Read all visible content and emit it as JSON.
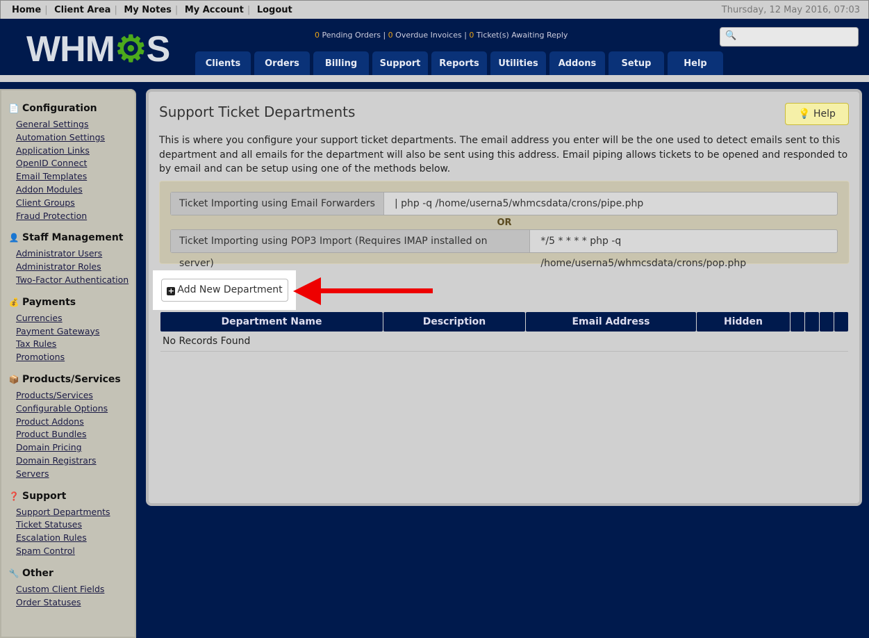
{
  "topbar": {
    "links": [
      "Home",
      "Client Area",
      "My Notes",
      "My Account",
      "Logout"
    ],
    "date": "Thursday, 12 May 2016, 07:03"
  },
  "header": {
    "logo": "WHMCS",
    "stats": {
      "pending": "0",
      "pending_label": "Pending Orders",
      "overdue": "0",
      "overdue_label": "Overdue Invoices",
      "tickets": "0",
      "tickets_label": "Ticket(s) Awaiting Reply"
    },
    "search_placeholder": "",
    "tabs": [
      "Clients",
      "Orders",
      "Billing",
      "Support",
      "Reports",
      "Utilities",
      "Addons",
      "Setup",
      "Help"
    ]
  },
  "sidebar": [
    {
      "title": "Configuration",
      "icon": "config-icon",
      "items": [
        "General Settings",
        "Automation Settings",
        "Application Links",
        "OpenID Connect",
        "Email Templates",
        "Addon Modules",
        "Client Groups",
        "Fraud Protection"
      ]
    },
    {
      "title": "Staff Management",
      "icon": "user-icon",
      "items": [
        "Administrator Users",
        "Administrator Roles",
        "Two-Factor Authentication"
      ]
    },
    {
      "title": "Payments",
      "icon": "coins-icon",
      "items": [
        "Currencies",
        "Payment Gateways",
        "Tax Rules",
        "Promotions"
      ]
    },
    {
      "title": "Products/Services",
      "icon": "box-icon",
      "items": [
        "Products/Services",
        "Configurable Options",
        "Product Addons",
        "Product Bundles",
        "Domain Pricing",
        "Domain Registrars",
        "Servers"
      ]
    },
    {
      "title": "Support",
      "icon": "support-icon",
      "items": [
        "Support Departments",
        "Ticket Statuses",
        "Escalation Rules",
        "Spam Control"
      ]
    },
    {
      "title": "Other",
      "icon": "wrench-icon",
      "items": [
        "Custom Client Fields",
        "Order Statuses"
      ]
    }
  ],
  "main": {
    "title": "Support Ticket Departments",
    "help_label": "Help",
    "description": "This is where you configure your support ticket departments. The email address you enter will be the one used to detect emails sent to this department and all emails for the department will also be sent using this address. Email piping allows tickets to be opened and responded to by email and can be setup using one of the methods below.",
    "forwarders_label": "Ticket Importing using Email Forwarders",
    "forwarders_value": "| php -q /home/userna5/whmcsdata/crons/pipe.php",
    "or": "OR",
    "pop3_label": "Ticket Importing using POP3 Import (Requires IMAP installed on server)",
    "pop3_value": "*/5 * * * * php -q /home/userna5/whmcsdata/crons/pop.php",
    "add_button": "Add New Department",
    "columns": [
      "Department Name",
      "Description",
      "Email Address",
      "Hidden"
    ],
    "empty": "No Records Found"
  },
  "colors": {
    "navy": "#001a4d",
    "tab": "#0a3278",
    "accent_arrow": "#ee0000"
  }
}
